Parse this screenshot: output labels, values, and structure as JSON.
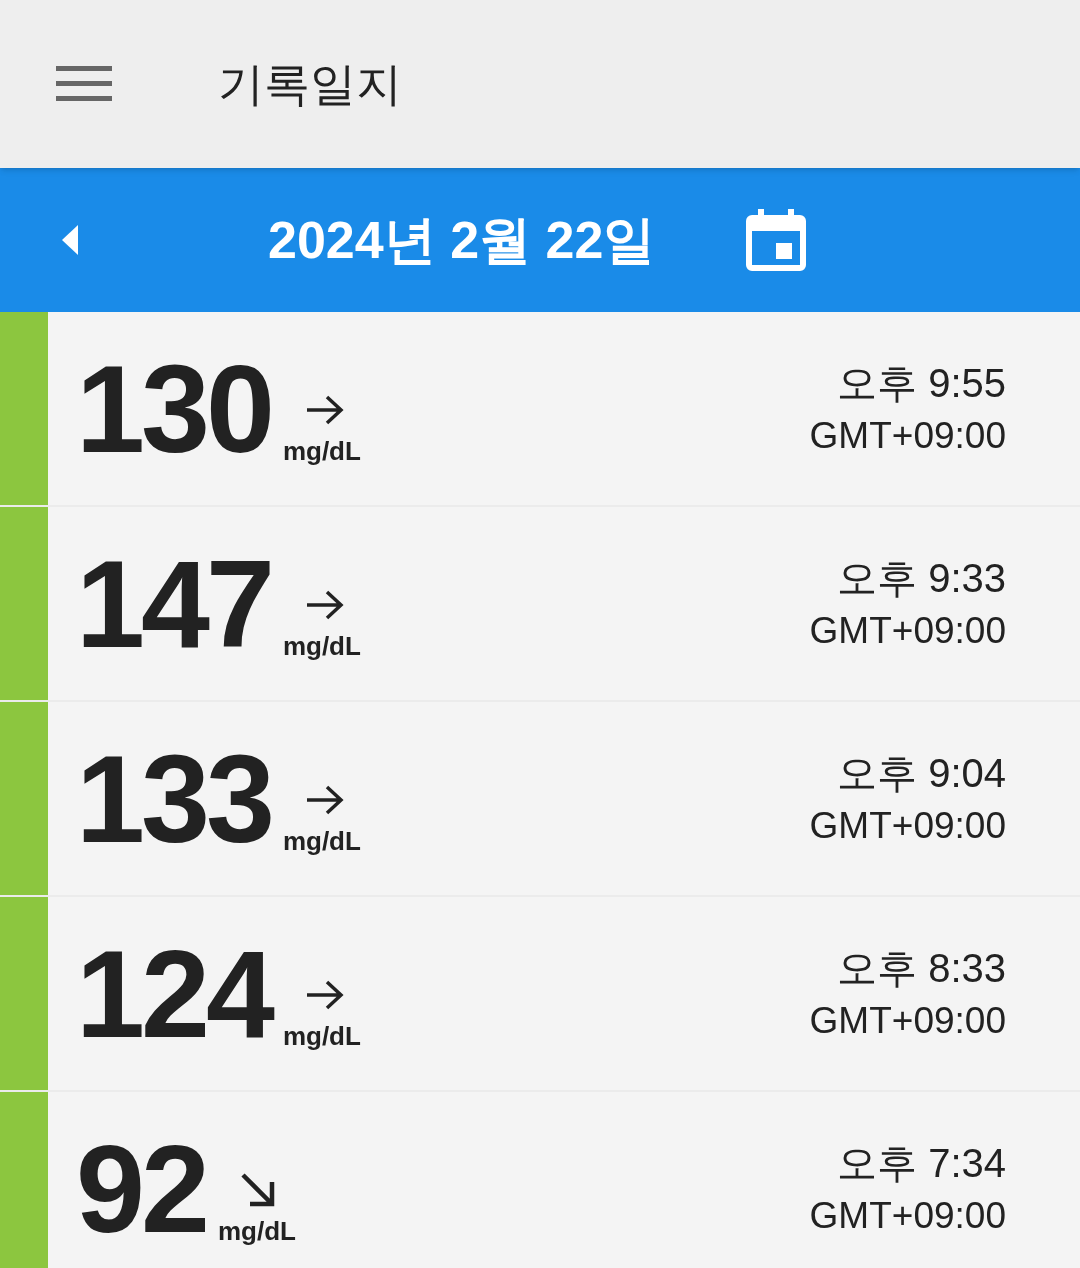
{
  "header": {
    "title": "기록일지"
  },
  "date_bar": {
    "date": "2024년 2월 22일"
  },
  "readings": [
    {
      "value": "130",
      "kind": "flat",
      "unit": "mg/dL",
      "time": "오후 9:55",
      "timezone": "GMT+09:00",
      "color": "#8cc63f"
    },
    {
      "value": "147",
      "kind": "flat",
      "unit": "mg/dL",
      "time": "오후 9:33",
      "timezone": "GMT+09:00",
      "color": "#8cc63f"
    },
    {
      "value": "133",
      "kind": "flat",
      "unit": "mg/dL",
      "time": "오후 9:04",
      "timezone": "GMT+09:00",
      "color": "#8cc63f"
    },
    {
      "value": "124",
      "kind": "flat",
      "unit": "mg/dL",
      "time": "오후 8:33",
      "timezone": "GMT+09:00",
      "color": "#8cc63f"
    },
    {
      "value": "92",
      "kind": "falling",
      "unit": "mg/dL",
      "time": "오후 7:34",
      "timezone": "GMT+09:00",
      "color": "#8cc63f"
    }
  ]
}
